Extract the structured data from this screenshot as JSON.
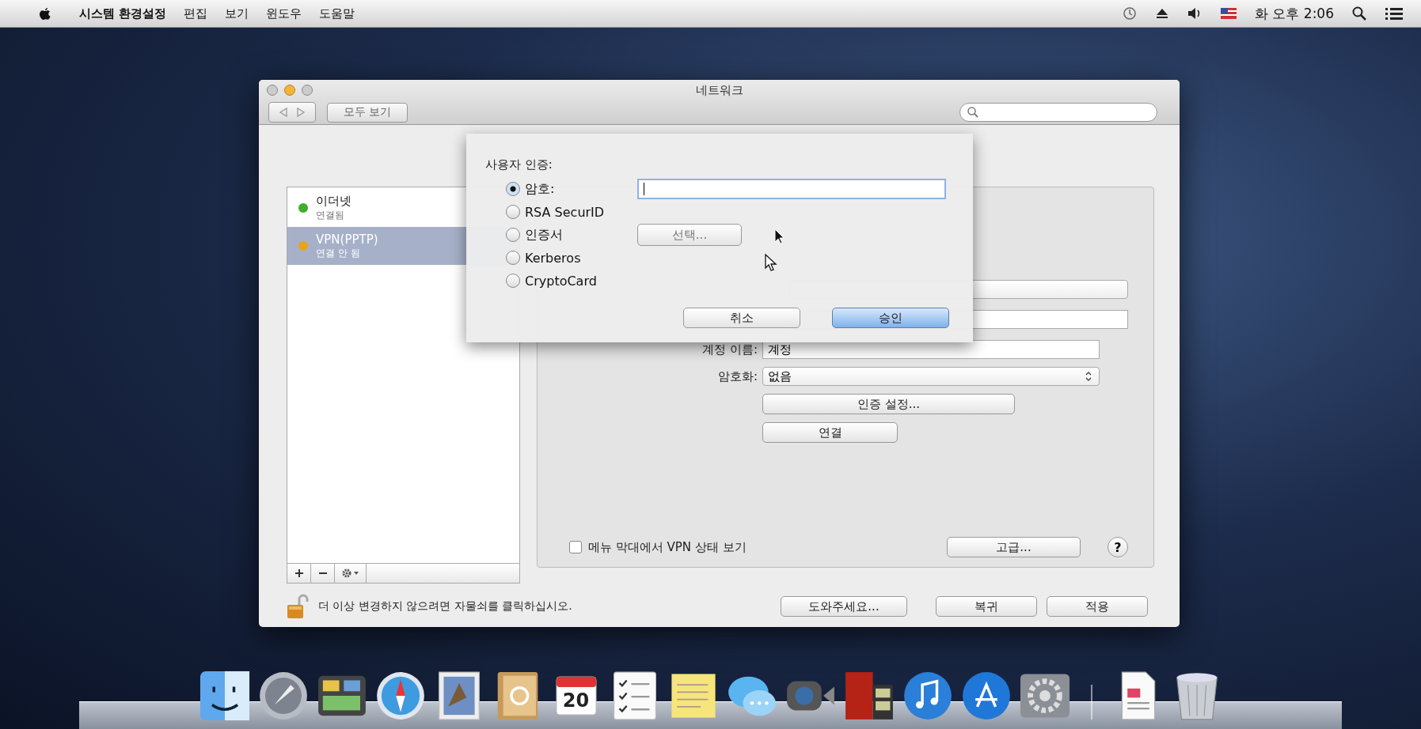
{
  "menu_bar": {
    "app_name": "시스템 환경설정",
    "menus": [
      "편집",
      "보기",
      "윈도우",
      "도움말"
    ],
    "clock": "화 오후 2:06"
  },
  "window": {
    "title": "네트워크",
    "show_all_button": "모두 보기"
  },
  "sidebar": {
    "items": [
      {
        "name": "이더넷",
        "status": "연결됨",
        "color": "#3fae2a",
        "selected": false
      },
      {
        "name": "VPN(PPTP)",
        "status": "연결 안 됨",
        "color": "#e8a21c",
        "selected": true
      }
    ]
  },
  "panel": {
    "rows": [
      {
        "kind": "field",
        "label": "계정 이름:",
        "value": "계정"
      },
      {
        "kind": "popup",
        "label": "암호화:",
        "value": "없음"
      },
      {
        "kind": "button",
        "label": "인증 설정..."
      },
      {
        "kind": "small-button",
        "label": "연결"
      }
    ],
    "show_vpn_status": {
      "label": "메뉴 막대에서 VPN 상태 보기",
      "checked": false
    },
    "advanced_button": "고급...",
    "help_button": "?"
  },
  "footer": {
    "lock_text": "더 이상 변경하지 않으려면 자물쇠를 클릭하십시오.",
    "buttons": [
      "도와주세요...",
      "복귀",
      "적용"
    ]
  },
  "sheet": {
    "title": "사용자 인증:",
    "options": [
      {
        "kind": "input",
        "label": "암호:",
        "selected": true
      },
      {
        "kind": "plain",
        "label": "RSA SecurID",
        "selected": false
      },
      {
        "kind": "choose",
        "label": "인증서",
        "button": "선택...",
        "selected": false
      },
      {
        "kind": "plain",
        "label": "Kerberos",
        "selected": false
      },
      {
        "kind": "plain",
        "label": "CryptoCard",
        "selected": false
      }
    ],
    "cancel_button": "취소",
    "ok_button": "승인"
  },
  "dock": {
    "items": [
      {
        "kind": "finder"
      },
      {
        "kind": "launchpad"
      },
      {
        "kind": "mission"
      },
      {
        "kind": "safari"
      },
      {
        "kind": "mail"
      },
      {
        "kind": "contacts"
      },
      {
        "kind": "calendar",
        "label": "20"
      },
      {
        "kind": "reminders"
      },
      {
        "kind": "notes"
      },
      {
        "kind": "messages"
      },
      {
        "kind": "facetime"
      },
      {
        "kind": "photobooth"
      },
      {
        "kind": "itunes"
      },
      {
        "kind": "appstore"
      },
      {
        "kind": "preferences"
      },
      {
        "kind": "separator"
      },
      {
        "kind": "document"
      },
      {
        "kind": "trash"
      }
    ]
  }
}
